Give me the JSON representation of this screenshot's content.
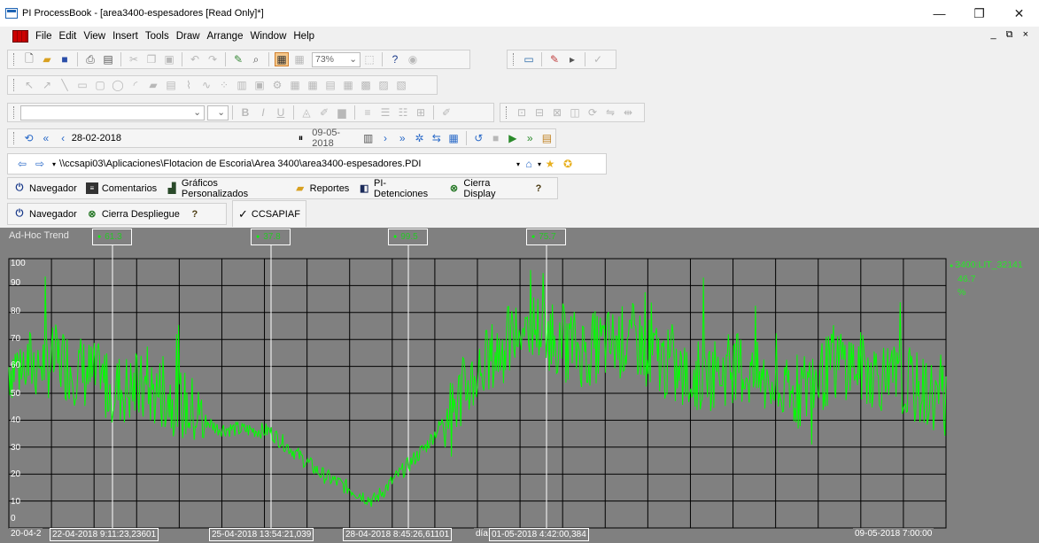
{
  "window": {
    "title": "PI ProcessBook - [area3400-espesadores [Read Only]*]",
    "controls": [
      "—",
      "❐",
      "✕"
    ]
  },
  "menu": {
    "items": [
      "File",
      "Edit",
      "View",
      "Insert",
      "Tools",
      "Draw",
      "Arrange",
      "Window",
      "Help"
    ],
    "right": "_ ⧉ ×"
  },
  "toolbar": {
    "zoom": "73%"
  },
  "nav": {
    "start_time": "28-02-2018",
    "end_time": "09-05-2018"
  },
  "address": {
    "path": "\\\\ccsapi03\\Aplicaciones\\Flotacion de Escoria\\Area 3400\\area3400-espesadores.PDI"
  },
  "links1": [
    "Navegador",
    "Comentarios",
    "Gráficos Personalizados",
    "Reportes",
    "PI-Detenciones",
    "Cierra Display"
  ],
  "links2": [
    "Navegador",
    "Cierra Despliegue"
  ],
  "tab": {
    "label": "CCSAPIAF"
  },
  "trend": {
    "title": "Ad-Hoc Trend",
    "cursors": [
      "61.3",
      "37.8",
      "99.5",
      "75.7"
    ],
    "legend": {
      "tag": "3400:LIT_32141",
      "value": "46.7",
      "unit": "%"
    },
    "y_ticks": [
      "100",
      "90",
      "80",
      "70",
      "60",
      "50",
      "40",
      "30",
      "20",
      "10",
      "0"
    ],
    "x_labels": [
      "20-04-2",
      "22-04-2018 9:11:23,23601",
      "25-04-2018 13:54:21,039",
      "28-04-2018 8:45:26,61101",
      "día",
      "01-05-2018 4:42:00,384",
      "09-05-2018 7:00:00"
    ]
  },
  "chart_data": {
    "type": "line",
    "ylim": [
      0,
      100
    ],
    "series": [
      {
        "name": "3400:LIT_32141",
        "x": [
          "20-04-2018",
          "22-04-2018",
          "23-04-2018",
          "25-04-2018",
          "26-04-2018",
          "27-04-2018",
          "28-04-2018",
          "28-04-2018 12:00",
          "29-04-2018",
          "30-04-2018",
          "01-05-2018",
          "02-05-2018",
          "03-05-2018",
          "04-05-2018",
          "05-05-2018",
          "06-05-2018",
          "07-05-2018",
          "08-05-2018",
          "09-05-2018 7:00"
        ],
        "values": [
          60,
          62,
          52,
          50,
          37,
          36,
          20,
          10,
          30,
          58,
          76,
          66,
          70,
          55,
          60,
          48,
          62,
          55,
          47
        ]
      }
    ],
    "colors": {
      "series": "#00ff00",
      "grid": "#000000",
      "background": "#808080",
      "cursor": "#ffffff"
    }
  }
}
